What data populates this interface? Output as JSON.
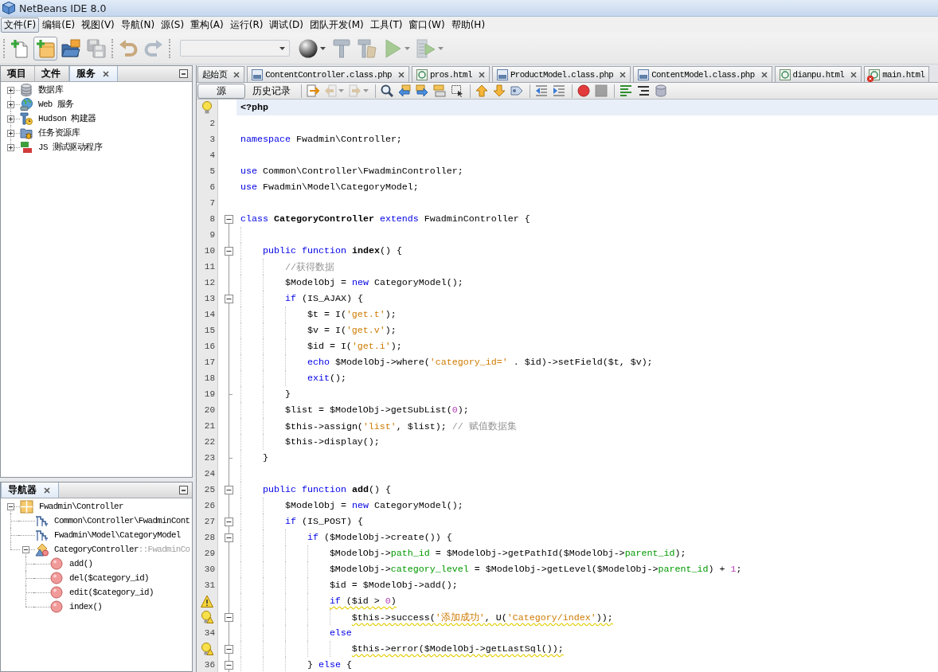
{
  "window": {
    "title": "NetBeans IDE 8.0"
  },
  "menu": [
    {
      "label": "文件(F)",
      "selected": true
    },
    {
      "label": "编辑(E)",
      "selected": false
    },
    {
      "label": "视图(V)",
      "selected": false
    },
    {
      "label": "导航(N)",
      "selected": false
    },
    {
      "label": "源(S)",
      "selected": false
    },
    {
      "label": "重构(A)",
      "selected": false
    },
    {
      "label": "运行(R)",
      "selected": false
    },
    {
      "label": "调试(D)",
      "selected": false
    },
    {
      "label": "团队开发(M)",
      "selected": false
    },
    {
      "label": "工具(T)",
      "selected": false
    },
    {
      "label": "窗口(W)",
      "selected": false
    },
    {
      "label": "帮助(H)",
      "selected": false
    }
  ],
  "toolbar": {
    "groups": [
      {
        "items": [
          {
            "kind": "button",
            "pressed": false,
            "disabled": false
          },
          {
            "kind": "button",
            "pressed": true,
            "disabled": false
          },
          {
            "kind": "button",
            "pressed": false,
            "disabled": false
          },
          {
            "kind": "button",
            "pressed": false,
            "disabled": true
          }
        ]
      },
      {
        "items": [
          {
            "kind": "button",
            "pressed": false,
            "disabled": false
          },
          {
            "kind": "button",
            "pressed": false,
            "disabled": true
          }
        ]
      },
      {
        "items": [
          {
            "kind": "combo",
            "disabled": true
          },
          {
            "kind": "split",
            "pressed": false,
            "disabled": false
          },
          {
            "kind": "button",
            "pressed": false,
            "disabled": true
          },
          {
            "kind": "button",
            "pressed": false,
            "disabled": true
          },
          {
            "kind": "split",
            "pressed": false,
            "disabled": true
          },
          {
            "kind": "split",
            "pressed": false,
            "disabled": true
          }
        ]
      }
    ]
  },
  "services_panel": {
    "tabs": [
      {
        "label": "项目",
        "selected": false
      },
      {
        "label": "文件",
        "selected": false
      },
      {
        "label": "服务",
        "selected": true
      }
    ],
    "tree": [
      {
        "label": "数据库",
        "expanded": false
      },
      {
        "label": "Web 服务",
        "expanded": false
      },
      {
        "label": "Hudson 构建器",
        "expanded": false
      },
      {
        "label": "任务资源库",
        "expanded": false
      },
      {
        "label": "JS 测试驱动程序",
        "expanded": false
      }
    ]
  },
  "navigator": {
    "tabs": [
      {
        "label": "导航器",
        "selected": true
      }
    ],
    "tree": [
      {
        "label": "Fwadmin\\Controller",
        "kind": "namespace",
        "expanded": true,
        "children": [
          {
            "label": "Common\\Controller\\FwadminCont",
            "kind": "use"
          },
          {
            "label": "Fwadmin\\Model\\CategoryModel",
            "kind": "use"
          },
          {
            "label": "CategoryController",
            "suffix": "::FwadminCo",
            "kind": "class",
            "expanded": true,
            "children": [
              {
                "label": "add()",
                "kind": "method"
              },
              {
                "label": "del($category_id)",
                "kind": "method"
              },
              {
                "label": "edit($category_id)",
                "kind": "method"
              },
              {
                "label": "index()",
                "kind": "method"
              }
            ]
          }
        ]
      }
    ]
  },
  "editor": {
    "tabs": [
      {
        "label": "起始页",
        "kind": "start",
        "selected": false,
        "close_button": true
      },
      {
        "label": "ContentController.class.php",
        "kind": "php",
        "selected": false,
        "close_button": true
      },
      {
        "label": "pros.html",
        "kind": "html",
        "selected": false,
        "close_button": true
      },
      {
        "label": "ProductModel.class.php",
        "kind": "php",
        "selected": false,
        "close_button": true
      },
      {
        "label": "ContentModel.class.php",
        "kind": "php",
        "selected": false,
        "close_button": true
      },
      {
        "label": "dianpu.html",
        "kind": "html",
        "selected": false,
        "close_button": true
      },
      {
        "label": "main.html",
        "kind": "html",
        "selected": false,
        "error": true,
        "close_button": false
      }
    ],
    "views": [
      {
        "label": "源",
        "selected": true
      },
      {
        "label": "历史记录",
        "selected": false
      }
    ],
    "toolbar": {
      "groups": [
        {
          "items": [
            {
              "kind": "button",
              "disabled": false
            },
            {
              "kind": "split",
              "disabled": true
            },
            {
              "kind": "split",
              "disabled": true
            }
          ]
        },
        {
          "items": [
            {
              "kind": "button",
              "disabled": false
            },
            {
              "kind": "button",
              "disabled": false
            },
            {
              "kind": "button",
              "disabled": false
            },
            {
              "kind": "button",
              "disabled": false
            },
            {
              "kind": "button",
              "disabled": false
            }
          ]
        },
        {
          "items": [
            {
              "kind": "button",
              "disabled": false
            },
            {
              "kind": "button",
              "disabled": false
            },
            {
              "kind": "button",
              "disabled": false
            }
          ]
        },
        {
          "items": [
            {
              "kind": "button",
              "disabled": false
            },
            {
              "kind": "button",
              "disabled": false
            }
          ]
        },
        {
          "items": [
            {
              "kind": "button",
              "disabled": false
            },
            {
              "kind": "button",
              "disabled": true
            }
          ]
        },
        {
          "items": [
            {
              "kind": "button",
              "disabled": false
            },
            {
              "kind": "button",
              "disabled": false
            },
            {
              "kind": "button",
              "disabled": false
            }
          ]
        }
      ]
    },
    "lines": [
      {
        "hint": true,
        "current": true,
        "tokens": [
          {
            "kind": "tag",
            "text": "<?php"
          }
        ]
      },
      {
        "number": "2",
        "current": false
      },
      {
        "number": "3",
        "current": false,
        "tokens": [
          {
            "kind": "keyword",
            "text": "namespace"
          },
          {
            "kind": "plain",
            "text": " Fwadmin\\Controller;"
          }
        ]
      },
      {
        "number": "4",
        "current": false
      },
      {
        "number": "5",
        "current": false,
        "tokens": [
          {
            "kind": "keyword",
            "text": "use"
          },
          {
            "kind": "plain",
            "text": " Common\\Controller\\FwadminController;"
          }
        ]
      },
      {
        "number": "6",
        "current": false,
        "tokens": [
          {
            "kind": "keyword",
            "text": "use"
          },
          {
            "kind": "plain",
            "text": " Fwadmin\\Model\\CategoryModel;"
          }
        ]
      },
      {
        "number": "7",
        "current": false
      },
      {
        "number": "8",
        "expanded": true,
        "current": false,
        "tokens": [
          {
            "kind": "keyword",
            "text": "class"
          },
          {
            "kind": "name",
            "text": " CategoryController"
          },
          {
            "kind": "keyword",
            "text": " extends"
          },
          {
            "kind": "plain",
            "text": " FwadminController {"
          }
        ],
        "children": [
          {
            "number": "9",
            "current": false
          },
          {
            "number": "10",
            "expanded": true,
            "current": false,
            "tokens": [
              {
                "kind": "keyword",
                "text": "public function"
              },
              {
                "kind": "name",
                "text": " index"
              },
              {
                "kind": "plain",
                "text": "() {"
              }
            ],
            "children": [
              {
                "number": "11",
                "current": false,
                "tokens": [
                  {
                    "kind": "comment",
                    "text": "//获得数据"
                  }
                ]
              },
              {
                "number": "12",
                "current": false,
                "tokens": [
                  {
                    "kind": "plain",
                    "text": "$ModelObj = "
                  },
                  {
                    "kind": "keyword",
                    "text": "new"
                  },
                  {
                    "kind": "plain",
                    "text": " CategoryModel();"
                  }
                ]
              },
              {
                "number": "13",
                "expanded": true,
                "current": false,
                "tokens": [
                  {
                    "kind": "keyword",
                    "text": "if"
                  },
                  {
                    "kind": "plain",
                    "text": " (IS_AJAX) {"
                  }
                ],
                "children": [
                  {
                    "number": "14",
                    "current": false,
                    "tokens": [
                      {
                        "kind": "plain",
                        "text": "$t = I("
                      },
                      {
                        "kind": "string",
                        "text": "'get.t'"
                      },
                      {
                        "kind": "plain",
                        "text": ");"
                      }
                    ]
                  },
                  {
                    "number": "15",
                    "current": false,
                    "tokens": [
                      {
                        "kind": "plain",
                        "text": "$v = I("
                      },
                      {
                        "kind": "string",
                        "text": "'get.v'"
                      },
                      {
                        "kind": "plain",
                        "text": ");"
                      }
                    ]
                  },
                  {
                    "number": "16",
                    "current": false,
                    "tokens": [
                      {
                        "kind": "plain",
                        "text": "$id = I("
                      },
                      {
                        "kind": "string",
                        "text": "'get.i'"
                      },
                      {
                        "kind": "plain",
                        "text": ");"
                      }
                    ]
                  },
                  {
                    "number": "17",
                    "current": false,
                    "tokens": [
                      {
                        "kind": "keyword",
                        "text": "echo"
                      },
                      {
                        "kind": "plain",
                        "text": " $ModelObj->where("
                      },
                      {
                        "kind": "string",
                        "text": "'category_id='"
                      },
                      {
                        "kind": "plain",
                        "text": " . $id)->setField($t, $v);"
                      }
                    ]
                  },
                  {
                    "number": "18",
                    "current": false,
                    "tokens": [
                      {
                        "kind": "keyword",
                        "text": "exit"
                      },
                      {
                        "kind": "plain",
                        "text": "();"
                      }
                    ]
                  }
                ]
              },
              {
                "number": "19",
                "fold_end": true,
                "current": false,
                "tokens": [
                  {
                    "kind": "plain",
                    "text": "}"
                  }
                ]
              },
              {
                "number": "20",
                "current": false,
                "tokens": [
                  {
                    "kind": "plain",
                    "text": "$list = $ModelObj->getSubList("
                  },
                  {
                    "kind": "number",
                    "text": "0"
                  },
                  {
                    "kind": "plain",
                    "text": ");"
                  }
                ]
              },
              {
                "number": "21",
                "current": false,
                "tokens": [
                  {
                    "kind": "plain",
                    "text": "$this->assign("
                  },
                  {
                    "kind": "string",
                    "text": "'list'"
                  },
                  {
                    "kind": "plain",
                    "text": ", $list); "
                  },
                  {
                    "kind": "comment",
                    "text": "// 赋值数据集"
                  }
                ]
              },
              {
                "number": "22",
                "current": false,
                "tokens": [
                  {
                    "kind": "plain",
                    "text": "$this->display();"
                  }
                ]
              }
            ]
          },
          {
            "number": "23",
            "fold_end": true,
            "current": false,
            "tokens": [
              {
                "kind": "plain",
                "text": "}"
              }
            ]
          },
          {
            "number": "24",
            "current": false
          },
          {
            "number": "25",
            "expanded": true,
            "current": false,
            "tokens": [
              {
                "kind": "keyword",
                "text": "public function"
              },
              {
                "kind": "name",
                "text": " add"
              },
              {
                "kind": "plain",
                "text": "() {"
              }
            ],
            "children": [
              {
                "number": "26",
                "current": false,
                "tokens": [
                  {
                    "kind": "plain",
                    "text": "$ModelObj = "
                  },
                  {
                    "kind": "keyword",
                    "text": "new"
                  },
                  {
                    "kind": "plain",
                    "text": " CategoryModel();"
                  }
                ]
              },
              {
                "number": "27",
                "expanded": true,
                "current": false,
                "tokens": [
                  {
                    "kind": "keyword",
                    "text": "if"
                  },
                  {
                    "kind": "plain",
                    "text": " (IS_POST) {"
                  }
                ],
                "children": [
                  {
                    "number": "28",
                    "expanded": true,
                    "current": false,
                    "tokens": [
                      {
                        "kind": "keyword",
                        "text": "if"
                      },
                      {
                        "kind": "plain",
                        "text": " ($ModelObj->create()) {"
                      }
                    ],
                    "children": [
                      {
                        "number": "29",
                        "current": false,
                        "tokens": [
                          {
                            "kind": "plain",
                            "text": "$ModelObj->"
                          },
                          {
                            "kind": "field",
                            "text": "path_id"
                          },
                          {
                            "kind": "plain",
                            "text": " = $ModelObj->getPathId($ModelObj->"
                          },
                          {
                            "kind": "field",
                            "text": "parent_id"
                          },
                          {
                            "kind": "plain",
                            "text": ");"
                          }
                        ]
                      },
                      {
                        "number": "30",
                        "current": false,
                        "tokens": [
                          {
                            "kind": "plain",
                            "text": "$ModelObj->"
                          },
                          {
                            "kind": "field",
                            "text": "category_level"
                          },
                          {
                            "kind": "plain",
                            "text": " = $ModelObj->getLevel($ModelObj->"
                          },
                          {
                            "kind": "field",
                            "text": "parent_id"
                          },
                          {
                            "kind": "plain",
                            "text": ") + "
                          },
                          {
                            "kind": "number",
                            "text": "1"
                          },
                          {
                            "kind": "plain",
                            "text": ";"
                          }
                        ]
                      },
                      {
                        "number": "31",
                        "current": false,
                        "tokens": [
                          {
                            "kind": "plain",
                            "text": "$id = $ModelObj->add();"
                          }
                        ]
                      },
                      {
                        "warning": true,
                        "current": false,
                        "underlined": true,
                        "tokens": [
                          {
                            "kind": "keyword",
                            "text": "if"
                          },
                          {
                            "kind": "plain",
                            "text": " ($id > "
                          },
                          {
                            "kind": "number",
                            "text": "0"
                          },
                          {
                            "kind": "plain",
                            "text": ")"
                          }
                        ],
                        "children": [
                          {
                            "hint": true,
                            "warning": true,
                            "expanded": true,
                            "current": false,
                            "underlined": true,
                            "tokens": [
                              {
                                "kind": "plain",
                                "text": "$this->success("
                              },
                              {
                                "kind": "string",
                                "text": "'添加成功'"
                              },
                              {
                                "kind": "plain",
                                "text": ", U("
                              },
                              {
                                "kind": "string",
                                "text": "'Category/index'"
                              },
                              {
                                "kind": "plain",
                                "text": "));"
                              }
                            ]
                          }
                        ]
                      },
                      {
                        "number": "34",
                        "current": false,
                        "tokens": [
                          {
                            "kind": "keyword",
                            "text": "else"
                          }
                        ],
                        "children": [
                          {
                            "hint": true,
                            "warning": true,
                            "expanded": true,
                            "current": false,
                            "underlined": true,
                            "tokens": [
                              {
                                "kind": "plain",
                                "text": "$this->error($ModelObj->getLastSql());"
                              }
                            ]
                          }
                        ]
                      }
                    ]
                  },
                  {
                    "number": "36",
                    "expanded": true,
                    "current": false,
                    "tokens": [
                      {
                        "kind": "plain",
                        "text": "} "
                      },
                      {
                        "kind": "keyword",
                        "text": "else"
                      },
                      {
                        "kind": "plain",
                        "text": " {"
                      }
                    ]
                  }
                ]
              }
            ]
          }
        ]
      }
    ]
  }
}
